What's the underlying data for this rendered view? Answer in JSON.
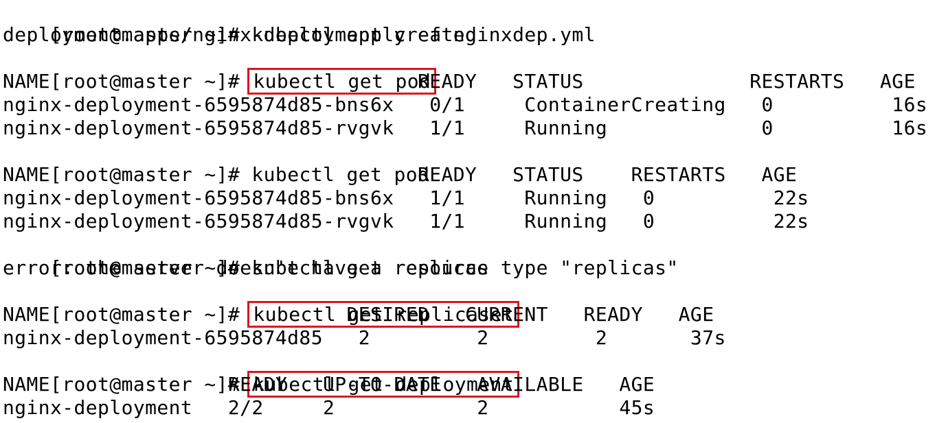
{
  "terminal": {
    "lines": [
      {
        "prompt": "[root@master ~]# ",
        "cmd": "kubectl apply -f nginxdep.yml"
      },
      {
        "text": "deployment.apps/nginx-deployment created"
      },
      {
        "prompt": "[root@master ~]# ",
        "cmd": "kubectl get pod",
        "boxed": true
      },
      {
        "text": "NAME                               READY   STATUS              RESTARTS   AGE"
      },
      {
        "text": "nginx-deployment-6595874d85-bns6x   0/1     ContainerCreating   0          16s"
      },
      {
        "text": "nginx-deployment-6595874d85-rvgvk   1/1     Running             0          16s"
      },
      {
        "prompt": "[root@master ~]# ",
        "cmd": "kubectl get pod"
      },
      {
        "text": "NAME                               READY   STATUS    RESTARTS   AGE"
      },
      {
        "text": "nginx-deployment-6595874d85-bns6x   1/1     Running   0          22s"
      },
      {
        "text": "nginx-deployment-6595874d85-rvgvk   1/1     Running   0          22s"
      },
      {
        "prompt": "[root@master ~]# ",
        "cmd": "kubectl get replicas"
      },
      {
        "text": "error: the server doesn't have a resource type \"replicas\""
      },
      {
        "prompt": "[root@master ~]# ",
        "cmd": "kubectl get replicaset",
        "boxed": true
      },
      {
        "text": "NAME                         DESIRED   CURRENT   READY   AGE"
      },
      {
        "text": "nginx-deployment-6595874d85   2         2         2       37s"
      },
      {
        "prompt": "[root@master ~]# ",
        "cmd": "kubectl get deployment",
        "boxed": true
      },
      {
        "text": "NAME               READY   UP-TO-DATE   AVAILABLE   AGE"
      },
      {
        "text": "nginx-deployment   2/2     2            2           45s"
      }
    ]
  }
}
